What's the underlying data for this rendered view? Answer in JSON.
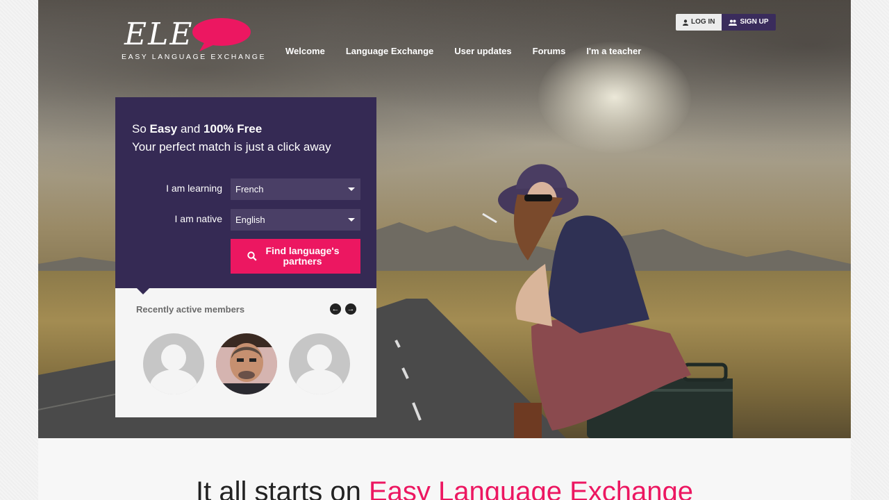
{
  "colors": {
    "brand_purple": "#352a54",
    "accent_pink": "#ec1761"
  },
  "logo": {
    "text": "ELE",
    "subtitle": "EASY LANGUAGE EXCHANGE"
  },
  "auth": {
    "login": "LOG IN",
    "signup": "SIGN UP",
    "login_icon": "user-icon",
    "signup_icon": "users-icon"
  },
  "nav": {
    "items": [
      "Welcome",
      "Language Exchange",
      "User updates",
      "Forums",
      "I'm a teacher"
    ]
  },
  "panel": {
    "so": "So ",
    "easy": "Easy",
    "and": " and ",
    "free": "100% Free",
    "subline": "Your perfect match is just a click away",
    "learning_label": "I am learning",
    "learning_value": "French",
    "native_label": "I am native",
    "native_value": "English",
    "find_button": "Find language's partners",
    "find_icon": "search-icon"
  },
  "members": {
    "title": "Recently active members",
    "prev_icon": "arrow-left-icon",
    "next_icon": "arrow-right-icon"
  },
  "tagline": {
    "prefix": "It all starts on ",
    "accent": "Easy Language Exchange"
  }
}
